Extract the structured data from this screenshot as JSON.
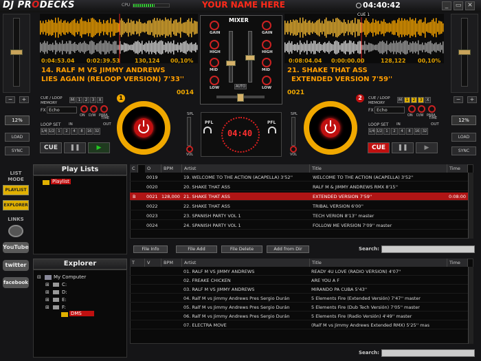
{
  "app": {
    "logo_left": "DJ PR",
    "logo_mid": "O",
    "logo_right": "DECKS",
    "banner": "YOUR NAME HERE",
    "cpu_label": "CPU",
    "clock": "04:40:42",
    "win_buttons": [
      "_",
      "▭",
      "✕"
    ]
  },
  "deck1": {
    "number": "1",
    "elapsed": "0:04:53.04",
    "remaining": "0:02:39.53",
    "position": "130,124",
    "pitch_pct": "00,10%",
    "title_line1": "14. RALF M VS JIMMY ANDREWS",
    "title_line2": "LIES AGAIN (RELOOP VERSION) 7'33''",
    "track_no": "0014",
    "bpm_box": "12%",
    "cue_loop_label": "CUE / LOOP MEMORY",
    "mem_buttons": [
      "M",
      "1",
      "2",
      "3",
      "X"
    ],
    "fx_label": "FX",
    "fx_value": "Echo",
    "on_label": "ON",
    "dw_label": "D/W",
    "para_label": "PARA",
    "time_label": "TIME",
    "loop_set_label": "LOOP SET",
    "loop_buttons": [
      "1/4",
      "1/2",
      "1",
      "2",
      "4",
      "8",
      "16",
      "32"
    ],
    "in_label": "IN",
    "out_label": "OUT",
    "cue_label": "CUE",
    "pause_label": "❚❚",
    "play_label": "▶",
    "load_label": "LOAD",
    "sync_label": "SYNC",
    "minus": "−",
    "plus": "+"
  },
  "deck2": {
    "number": "2",
    "cue_marker": "CUE 1",
    "elapsed": "0:08:04.04",
    "remaining": "0:00:00.00",
    "position": "128,122",
    "pitch_pct": "00,10%",
    "title_line1": "21. SHAKE THAT ASS",
    "title_line2": "EXTENDED VERSION 7'59''",
    "track_no": "0021",
    "bpm_box": "12%",
    "cue_loop_label": "CUE / LOOP MEMORY",
    "mem_buttons": [
      "M",
      "1",
      "2",
      "3",
      "X"
    ],
    "fx_label": "FX",
    "fx_value": "Echo",
    "on_label": "ON",
    "dw_label": "D/W",
    "para_label": "PARA",
    "time_label": "TIME",
    "loop_set_label": "LOOP SET",
    "loop_buttons": [
      "1/4",
      "1/2",
      "1",
      "2",
      "4",
      "8",
      "16",
      "32"
    ],
    "in_label": "IN",
    "out_label": "OUT",
    "cue_label": "CUE",
    "pause_label": "❚❚",
    "play_label": "▶",
    "load_label": "LOAD",
    "sync_label": "SYNC",
    "minus": "−",
    "plus": "+"
  },
  "mixer": {
    "title": "MIXER",
    "gain": "GAIN",
    "high": "HIGH",
    "mid": "MID",
    "low": "LOW",
    "auto": "AUTO",
    "spl": "SPL",
    "pfl": "PFL",
    "vol": "VOL",
    "center_clock": "04:40"
  },
  "sidebar": {
    "list_mode": "LIST MODE",
    "playlist": "PLAYLIST",
    "explorer": "EXPLORER",
    "links": "LINKS",
    "youtube": "YouTube",
    "twitter": "twitter",
    "facebook": "facebook"
  },
  "playlists": {
    "header": "Play Lists",
    "item": "Playlist"
  },
  "explorer": {
    "header": "Explorer",
    "root": "My Computer",
    "drives": [
      "C:",
      "D:",
      "E:",
      "F:"
    ],
    "folder": "DMS"
  },
  "table1": {
    "headers": [
      "C",
      "O",
      "BPM",
      "Artist",
      "Title",
      "Time"
    ],
    "rows": [
      {
        "c": "",
        "o": "0019",
        "bpm": "",
        "artist": "19. WELCOME TO THE ACTION (ACAPELLA) 3'52''",
        "title": "WELCOME TO THE ACTION (ACAPELLA) 3'52''",
        "time": ""
      },
      {
        "c": "",
        "o": "0020",
        "bpm": "",
        "artist": "20. SHAKE THAT ASS",
        "title": "RALF M & JIMMY ANDREWS RMX 8'15''",
        "time": ""
      },
      {
        "c": "B",
        "o": "0021",
        "bpm": "128,000",
        "artist": "21. SHAKE THAT ASS",
        "title": "EXTENDED VERSION 7'59''",
        "time": "0:08:00"
      },
      {
        "c": "",
        "o": "0022",
        "bpm": "",
        "artist": "22. SHAKE THAT ASS",
        "title": "TRIBAL VERSION 6'00''",
        "time": ""
      },
      {
        "c": "",
        "o": "0023",
        "bpm": "",
        "artist": "23. SPANISH PARTY VOL 1",
        "title": "TECH VERION 8'13'' master",
        "time": ""
      },
      {
        "c": "",
        "o": "0024",
        "bpm": "",
        "artist": "24. SPANISH PARTY VOL 1",
        "title": "FOLLOW ME VERSION 7'09'' master",
        "time": ""
      }
    ]
  },
  "toolbar": {
    "file_info": "File Info",
    "file_add": "File Add",
    "file_delete": "File Delete",
    "add_from_dir": "Add from Dir",
    "search": "Search:"
  },
  "table2": {
    "headers": [
      "T",
      "V",
      "BPM",
      "Artist",
      "Title",
      "Time"
    ],
    "rows": [
      {
        "artist": "01. RALF M VS JIMMY ANDREWS",
        "title": "READY 4U LOVE (RADIO VERSION) 4'07''"
      },
      {
        "artist": "02. FREAKE CHICKEN",
        "title": "ARE YOU A F"
      },
      {
        "artist": "03. RALF M VS JIMMY ANDREWS",
        "title": "MIRANDO PA CUBA 5'43''"
      },
      {
        "artist": "04. Ralf M vs Jimmy Andrews Pres Sergio Durán",
        "title": "5 Elements Fire (Extended Versión) 7'47'' master"
      },
      {
        "artist": "05. Ralf M vs Jimmy Andrews Pres Sergio Durán",
        "title": "5 Elements Fire (Dub Tech Versión) 7'05'' master"
      },
      {
        "artist": "06. Ralf M vs Jimmy Andrews Pres Sergio Durán",
        "title": "5 Elements Fire (Radio Versión) 4'49'' master"
      },
      {
        "artist": "07. ELECTRA MOVE",
        "title": "(Ralf M vs Jimmy Andrews Extended RMX) 5'25'' mas"
      }
    ],
    "search": "Search:"
  },
  "colors": {
    "accent": "#f0a800",
    "red": "#c01010",
    "wave_yellow": "#f0a000",
    "wave_white": "#cccccc"
  }
}
